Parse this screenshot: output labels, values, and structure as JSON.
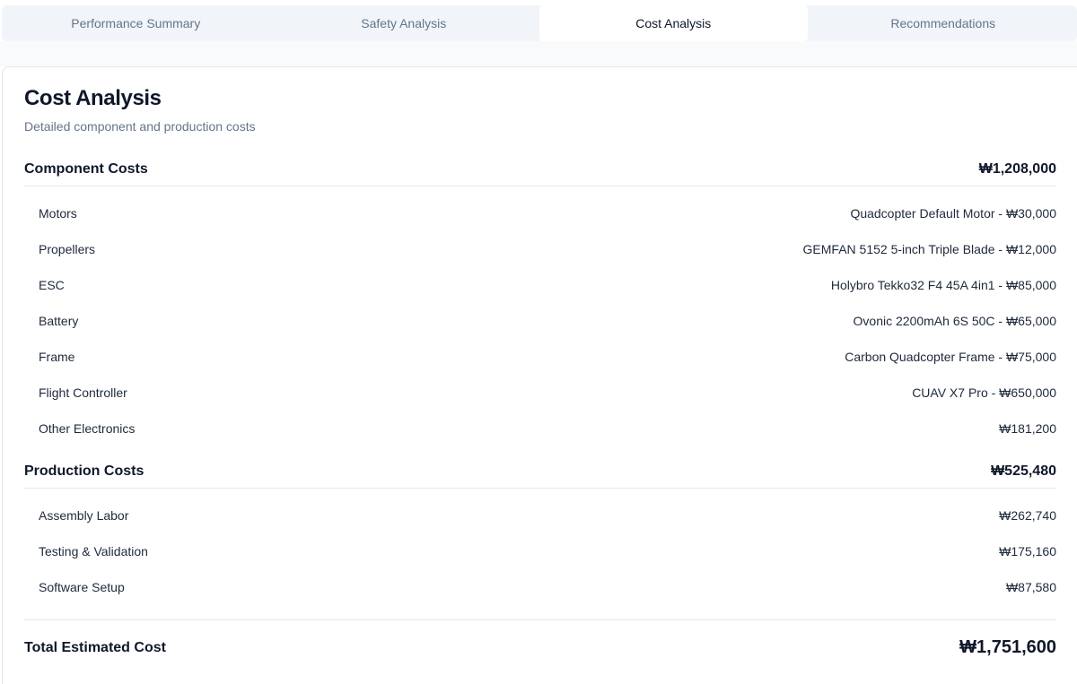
{
  "tabs": [
    {
      "label": "Performance Summary",
      "active": false
    },
    {
      "label": "Safety Analysis",
      "active": false
    },
    {
      "label": "Cost Analysis",
      "active": true
    },
    {
      "label": "Recommendations",
      "active": false
    }
  ],
  "card": {
    "title": "Cost Analysis",
    "subtitle": "Detailed component and production costs"
  },
  "component_costs": {
    "label": "Component Costs",
    "total": "₩1,208,000",
    "items": [
      {
        "name": "Motors",
        "value": "Quadcopter Default Motor - ₩30,000"
      },
      {
        "name": "Propellers",
        "value": "GEMFAN 5152 5-inch Triple Blade - ₩12,000"
      },
      {
        "name": "ESC",
        "value": "Holybro Tekko32 F4 45A 4in1 - ₩85,000"
      },
      {
        "name": "Battery",
        "value": "Ovonic 2200mAh 6S 50C - ₩65,000"
      },
      {
        "name": "Frame",
        "value": "Carbon Quadcopter Frame - ₩75,000"
      },
      {
        "name": "Flight Controller",
        "value": "CUAV X7 Pro - ₩650,000"
      },
      {
        "name": "Other Electronics",
        "value": "₩181,200"
      }
    ]
  },
  "production_costs": {
    "label": "Production Costs",
    "total": "₩525,480",
    "items": [
      {
        "name": "Assembly Labor",
        "value": "₩262,740"
      },
      {
        "name": "Testing & Validation",
        "value": "₩175,160"
      },
      {
        "name": "Software Setup",
        "value": "₩87,580"
      }
    ]
  },
  "total": {
    "label": "Total Estimated Cost",
    "value": "₩1,751,600"
  }
}
